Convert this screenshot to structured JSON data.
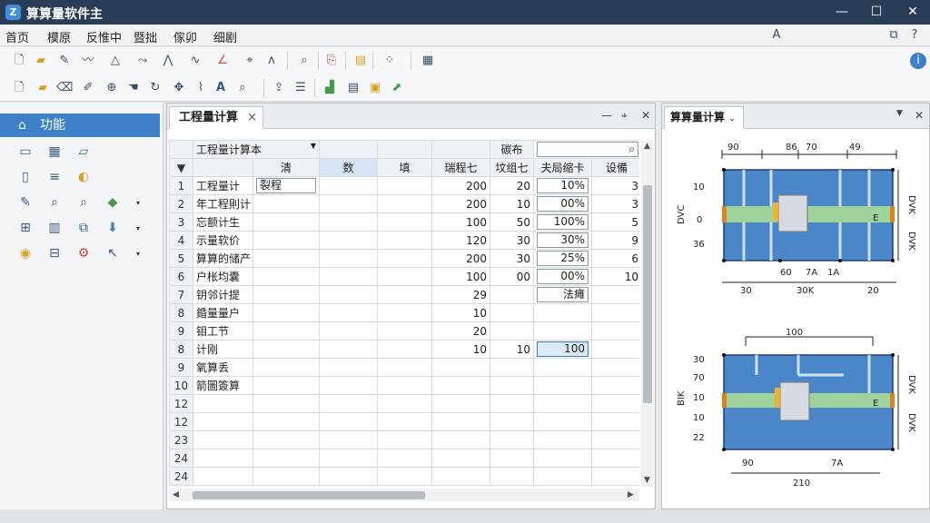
{
  "app": {
    "title": "算算量软件主",
    "logo_glyph": "Z"
  },
  "window_controls": {
    "minimize": "—",
    "maximize": "☐",
    "close": "✕"
  },
  "menu": [
    "首页",
    "模原",
    "反惟中",
    "暨拙",
    "傢卯",
    "细剧"
  ],
  "search": {
    "placeholder": ""
  },
  "left_panel": {
    "title": "功能"
  },
  "doc_tab": {
    "label": "工程量计算"
  },
  "grid": {
    "dropdown_value": "工程量计算本",
    "header_label": "碳布",
    "col_headers": [
      "清",
      "数",
      "填",
      "瑞程七",
      "坟组七",
      "夫局缩卡",
      "设備"
    ],
    "rows": [
      {
        "num": "1",
        "name": "工程量计",
        "c1": "裂程",
        "c4": "200",
        "c5": "20",
        "c6": "10%",
        "c7": "3"
      },
      {
        "num": "2",
        "name": "年工程則计",
        "c1": "",
        "c4": "200",
        "c5": "10",
        "c6": "00%",
        "c7": "3"
      },
      {
        "num": "3",
        "name": "忘额计生",
        "c1": "",
        "c4": "100",
        "c5": "50",
        "c6": "100%",
        "c7": "5"
      },
      {
        "num": "4",
        "name": "示量软价",
        "c1": "",
        "c4": "120",
        "c5": "30",
        "c6": "30%",
        "c7": "9"
      },
      {
        "num": "5",
        "name": "算算的储产",
        "c1": "",
        "c4": "200",
        "c5": "30",
        "c6": "25%",
        "c7": "6"
      },
      {
        "num": "6",
        "name": "户枨均囊",
        "c1": "",
        "c4": "100",
        "c5": "00",
        "c6": "00%",
        "c7": "10"
      },
      {
        "num": "7",
        "name": "钥邻计提",
        "c1": "",
        "c4": "29",
        "c5": "",
        "c6": "法瘫",
        "c7": ""
      },
      {
        "num": "8",
        "name": "錉量量户",
        "c1": "",
        "c4": "10",
        "c5": "",
        "c6": "",
        "c7": ""
      },
      {
        "num": "9",
        "name": "钼工节",
        "c1": "",
        "c4": "20",
        "c5": "",
        "c6": "",
        "c7": ""
      },
      {
        "num": "8",
        "name": "计刚",
        "c1": "",
        "c4": "10",
        "c5": "10",
        "c6": "100",
        "c7": ""
      },
      {
        "num": "9",
        "name": "氧算丢",
        "c1": "",
        "c4": "",
        "c5": "",
        "c6": "",
        "c7": ""
      },
      {
        "num": "10",
        "name": "箭圖簽算",
        "c1": "",
        "c4": "",
        "c5": "",
        "c6": "",
        "c7": ""
      },
      {
        "num": "12",
        "name": "",
        "c1": "",
        "c4": "",
        "c5": "",
        "c6": "",
        "c7": ""
      },
      {
        "num": "12",
        "name": "",
        "c1": "",
        "c4": "",
        "c5": "",
        "c6": "",
        "c7": ""
      },
      {
        "num": "23",
        "name": "",
        "c1": "",
        "c4": "",
        "c5": "",
        "c6": "",
        "c7": ""
      },
      {
        "num": "24",
        "name": "",
        "c1": "",
        "c4": "",
        "c5": "",
        "c6": "",
        "c7": ""
      },
      {
        "num": "24",
        "name": "",
        "c1": "",
        "c4": "",
        "c5": "",
        "c6": "",
        "c7": ""
      }
    ]
  },
  "right_panel": {
    "tab_label": "算算量计算",
    "plan1": {
      "top_dims": [
        "90",
        "86",
        "70",
        "49"
      ],
      "left_dims": [
        "10",
        "0",
        "36"
      ],
      "left_side": "DVC",
      "right_side_a": "DVK",
      "right_side_b": "DVK",
      "right_mark": "E",
      "bottom_inner": [
        "60",
        "7A",
        "1A"
      ],
      "bottom_outer": [
        "30",
        "30K",
        "20"
      ]
    },
    "plan2": {
      "top_dims": [
        "100"
      ],
      "left_dims": [
        "30",
        "70",
        "10",
        "10",
        "22"
      ],
      "left_side": "BIK",
      "right_side_a": "DVK",
      "right_side_b": "DVK",
      "right_mark": "E",
      "bottom_inner": [
        "90",
        "7A"
      ],
      "bottom_outer": [
        "210"
      ]
    }
  },
  "colors": {
    "titlebar": "#2a3d57",
    "accent": "#3d80c8",
    "plan_fill": "#4a86c8",
    "band": "#9fd39b"
  }
}
